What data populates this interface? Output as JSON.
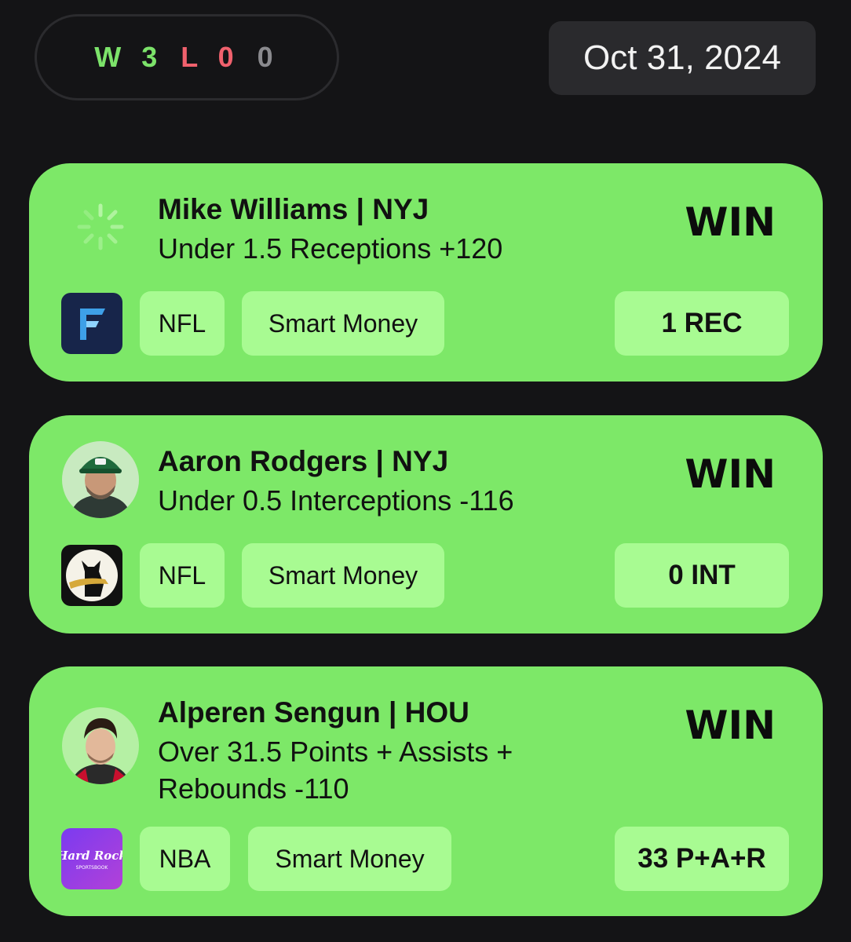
{
  "header": {
    "record": {
      "wins": "W 3",
      "losses": "L 0",
      "pushes": "0"
    },
    "date": "Oct 31, 2024"
  },
  "colors": {
    "card_bg": "#7de868",
    "tag_bg": "#a8fb92",
    "win_record": "#7ce36a",
    "loss_record": "#f0616d",
    "push_record": "#8a8a8e",
    "page_bg": "#141416"
  },
  "picks": [
    {
      "avatar_icon": "loading-spinner-icon",
      "player": "Mike Williams | NYJ",
      "bet": "Under 1.5 Receptions +120",
      "result": "WIN",
      "book_icon": "fliff-logo-icon",
      "league": "NFL",
      "source": "Smart Money",
      "stat": "1 REC"
    },
    {
      "avatar_icon": "player-photo-aaron-rodgers",
      "player": "Aaron Rodgers | NYJ",
      "bet": "Under 0.5 Interceptions -116",
      "result": "WIN",
      "book_icon": "dog-logo-icon",
      "league": "NFL",
      "source": "Smart Money",
      "stat": "0 INT"
    },
    {
      "avatar_icon": "player-photo-alperen-sengun",
      "player": "Alperen Sengun | HOU",
      "bet_line1": "Over 31.5 Points + Assists +",
      "bet_line2": "Rebounds -110",
      "result": "WIN",
      "book_icon": "hard-rock-sportsbook-logo-icon",
      "book_text": "Hard Rock",
      "book_subtext": "SPORTSBOOK",
      "league": "NBA",
      "source": "Smart Money",
      "stat": "33 P+A+R"
    }
  ]
}
